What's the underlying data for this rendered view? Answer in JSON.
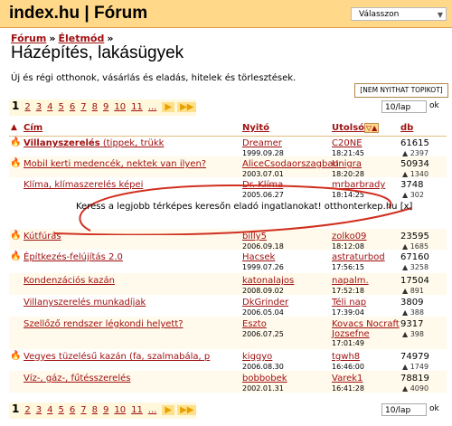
{
  "header": {
    "title": "index.hu | Fórum",
    "select_value": "Válasszon"
  },
  "breadcrumb": [
    "Fórum",
    "Életmód"
  ],
  "breadcrumb_sep": "»",
  "page_title": "Házépítés, lakásügyek",
  "description": "Új és régi otthonok, vásárlás és eladás, hitelek és törlesztések.",
  "hide_button": "[NEM NYITHAT TOPIKOT]",
  "pager": {
    "current": "1",
    "pages": [
      "2",
      "3",
      "4",
      "5",
      "6",
      "7",
      "8",
      "9",
      "10",
      "11",
      "..."
    ],
    "per_page": "10/lap",
    "ok": "ok"
  },
  "columns": {
    "title": "Cím",
    "starter": "Nyitó",
    "last": "Utolsó",
    "count": "db"
  },
  "rows": [
    {
      "title": "Villanyszerelés",
      "tail": " (tippek, trükk",
      "hot": true,
      "flame": "orange",
      "starter": "Dreamer",
      "start_date": "1999.09.28",
      "last_user": "C20NE",
      "last_time": "18:21:45",
      "count": "61615",
      "sub": "▲ 2397"
    },
    {
      "title": "Mobil kerti medencék, nektek van ilyen?",
      "tail": "",
      "hot": false,
      "flame": "orange",
      "starter": "AliceCsodaorszagban",
      "start_date": "2003.07.01",
      "last_user": "Unigra",
      "last_time": "18:20:28",
      "count": "50934",
      "sub": "▲ 1340"
    },
    {
      "title": "Klíma, klímaszerelés képei",
      "tail": "",
      "hot": false,
      "flame": "",
      "starter": "Dr. Klíma",
      "start_date": "2005.06.27",
      "last_user": "mrbarbrady",
      "last_time": "18:14:25",
      "count": "3748",
      "sub": "▲ 302"
    },
    {
      "title": "Kútfúrás",
      "tail": "",
      "hot": false,
      "flame": "orange",
      "starter": "billy5",
      "start_date": "2006.09.18",
      "last_user": "zolko09",
      "last_time": "18:12:08",
      "count": "23595",
      "sub": "▲ 1685"
    },
    {
      "title": "Építkezés-felújítás 2.0",
      "tail": "",
      "hot": false,
      "flame": "orange",
      "starter": "Hacsek",
      "start_date": "1999.07.26",
      "last_user": "astraturbod",
      "last_time": "17:56:15",
      "count": "67160",
      "sub": "▲ 3258"
    },
    {
      "title": "Kondenzációs kazán",
      "tail": "",
      "hot": false,
      "flame": "",
      "starter": "katonalajos",
      "start_date": "2008.09.02",
      "last_user": "napalm.",
      "last_time": "17:52:18",
      "count": "17504",
      "sub": "▲ 891"
    },
    {
      "title": "Villanyszerelés munkadíjak",
      "tail": "",
      "hot": false,
      "flame": "",
      "starter": "DkGrinder",
      "start_date": "2006.05.04",
      "last_user": "Téli nap",
      "last_time": "17:39:04",
      "count": "3809",
      "sub": "▲ 388"
    },
    {
      "title": "Szellőző rendszer légkondi helyett?",
      "tail": "",
      "hot": false,
      "flame": "",
      "starter": "Eszto",
      "start_date": "2006.07.25",
      "last_user": "Kovacs Nocraft Jozsefne",
      "last_time": "17:01:49",
      "count": "9317",
      "sub": "▲ 398"
    },
    {
      "title": "Vegyes tüzelésű kazán (fa, szalmabála, p",
      "tail": "",
      "hot": false,
      "flame": "orange",
      "starter": "kiggyo",
      "start_date": "2006.08.30",
      "last_user": "tgwh8",
      "last_time": "16:46:00",
      "count": "74979",
      "sub": "▲ 1749"
    },
    {
      "title": "Víz-, gáz-, fűtésszerelés",
      "tail": "",
      "hot": false,
      "flame": "",
      "starter": "bobbobek",
      "start_date": "2002.01.31",
      "last_user": "Varek1",
      "last_time": "16:41:28",
      "count": "78819",
      "sub": "▲ 4090"
    }
  ],
  "ad": {
    "text": "Keress a legjobb térképes keresőn eladó ingatlanokat! otthonterkep.hu",
    "close": "[x]"
  }
}
